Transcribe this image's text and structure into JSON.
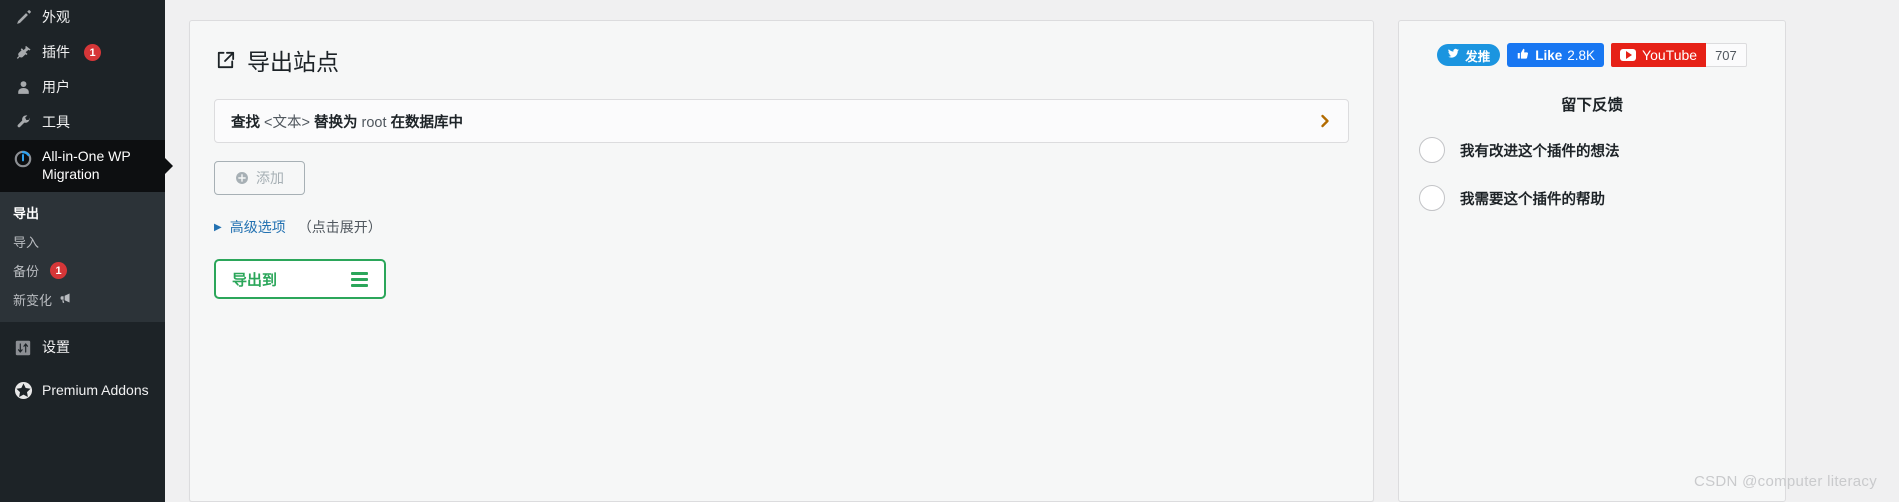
{
  "sidebar": {
    "items": [
      {
        "label": "外观",
        "icon": "appearance-brush-icon",
        "badge": null
      },
      {
        "label": "插件",
        "icon": "plugins-plug-icon",
        "badge": "1"
      },
      {
        "label": "用户",
        "icon": "users-person-icon",
        "badge": null
      },
      {
        "label": "工具",
        "icon": "tools-wrench-icon",
        "badge": null
      }
    ],
    "active_item": {
      "label": "All-in-One WP Migration",
      "icon": "aiowpm-logo-icon"
    },
    "submenu": [
      {
        "label": "导出",
        "current": true,
        "badge": null,
        "icon": null
      },
      {
        "label": "导入",
        "current": false,
        "badge": null,
        "icon": null
      },
      {
        "label": "备份",
        "current": false,
        "badge": "1",
        "icon": null
      },
      {
        "label": "新变化",
        "current": false,
        "badge": null,
        "icon": "megaphone-icon"
      }
    ],
    "settings": {
      "label": "设置",
      "icon": "settings-sliders-icon"
    },
    "premium": {
      "label": "Premium Addons",
      "icon": "premium-star-icon"
    }
  },
  "main": {
    "title": "导出站点",
    "title_icon": "export-box-arrow-icon",
    "find_replace": {
      "find_label": "查找",
      "find_value": "<文本>",
      "replace_label": "替换为",
      "replace_value": "root",
      "scope_label": "在数据库中",
      "chevron_icon": "chevron-right-icon"
    },
    "add_button": {
      "label": "添加",
      "icon": "plus-circle-icon"
    },
    "advanced": {
      "caret_icon": "caret-right-icon",
      "link": "高级选项",
      "hint": "（点击展开）"
    },
    "export_button": {
      "label": "导出到",
      "icon": "hamburger-menu-icon"
    }
  },
  "side_panel": {
    "social": {
      "twitter": {
        "label": "发推",
        "icon": "twitter-bird-icon"
      },
      "facebook": {
        "label": "Like",
        "count": "2.8K",
        "icon": "thumbs-up-icon"
      },
      "youtube": {
        "label": "YouTube",
        "count": "707",
        "icon": "youtube-play-icon"
      }
    },
    "feedback_title": "留下反馈",
    "options": [
      {
        "label": "我有改进这个插件的想法"
      },
      {
        "label": "我需要这个插件的帮助"
      }
    ]
  },
  "watermark": "CSDN @computer literacy",
  "colors": {
    "sidebar_bg": "#1d2327",
    "sidebar_active_bg": "#0d0f11",
    "submenu_bg": "#2c3338",
    "badge_red": "#d63638",
    "link_blue": "#2271b1",
    "export_green": "#2ba65a",
    "twitter_blue": "#1b95e0",
    "facebook_blue": "#1877f2",
    "youtube_red": "#e62117",
    "page_bg": "#f0f0f1",
    "card_bg": "#f6f7f7"
  }
}
